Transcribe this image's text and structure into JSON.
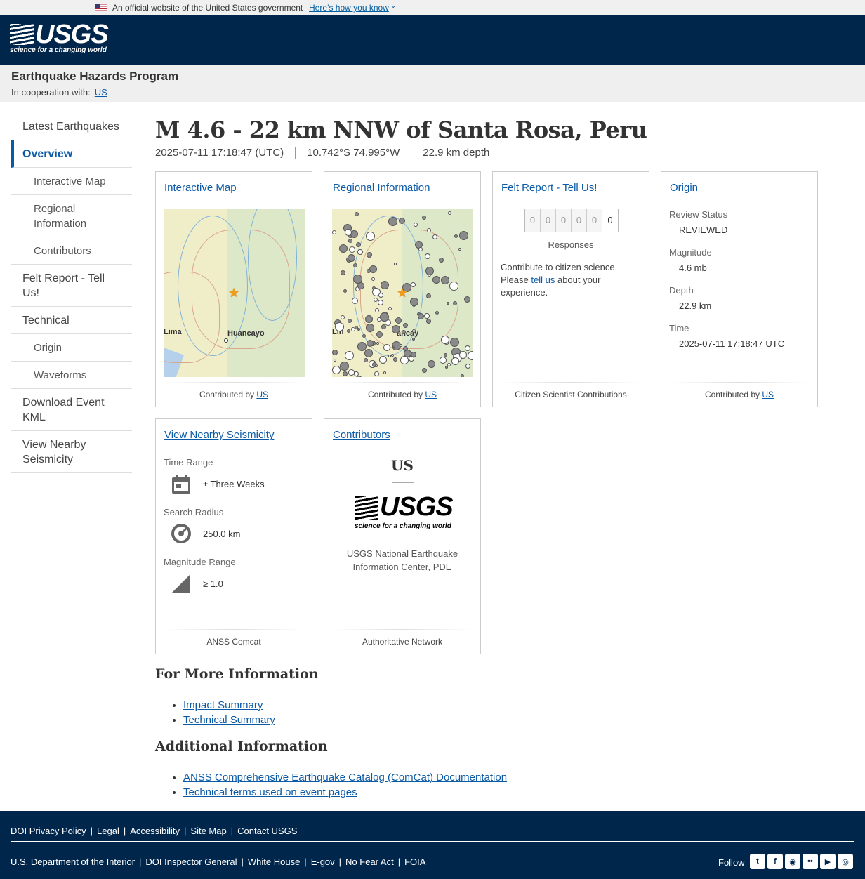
{
  "gov_banner": {
    "official_text": "An official website of the United States government",
    "how_link": "Here’s how you know"
  },
  "header": {
    "logo_word": "USGS",
    "logo_tagline": "science for a changing world"
  },
  "program": {
    "title": "Earthquake Hazards Program",
    "coop_label": "In cooperation with:",
    "coop_link": "US"
  },
  "sidebar": {
    "items": [
      {
        "label": "Latest Earthquakes"
      },
      {
        "label": "Overview"
      },
      {
        "label": "Interactive Map"
      },
      {
        "label": "Regional Information"
      },
      {
        "label": "Contributors"
      },
      {
        "label": "Felt Report - Tell Us!"
      },
      {
        "label": "Technical"
      },
      {
        "label": "Origin"
      },
      {
        "label": "Waveforms"
      },
      {
        "label": "Download Event KML"
      },
      {
        "label": "View Nearby Seismicity"
      }
    ]
  },
  "event": {
    "title": "M 4.6 - 22 km NNW of Santa Rosa, Peru",
    "time": "2025-07-11 17:18:47 (UTC)",
    "location": "10.742°S 74.995°W",
    "depth": "22.9 km depth"
  },
  "cards": {
    "interactive_map": {
      "title": "Interactive Map",
      "city_lima": "Lima",
      "city_huancayo": "Huancayo",
      "foot_prefix": "Contributed by",
      "foot_link": "US"
    },
    "regional": {
      "title": "Regional Information",
      "city_lima": "Lin",
      "city_huancayo": "ancay",
      "foot_prefix": "Contributed by",
      "foot_link": "US"
    },
    "felt": {
      "title": "Felt Report - Tell Us!",
      "digits": [
        "0",
        "0",
        "0",
        "0",
        "0",
        "0"
      ],
      "responses": "Responses",
      "text_before": "Contribute to citizen science. Please",
      "text_link": "tell us",
      "text_after": "about your experience.",
      "foot": "Citizen Scientist Contributions"
    },
    "origin": {
      "title": "Origin",
      "review_label": "Review Status",
      "review_value": "REVIEWED",
      "magnitude_label": "Magnitude",
      "magnitude_value": "4.6 mb",
      "depth_label": "Depth",
      "depth_value": "22.9 km",
      "time_label": "Time",
      "time_value": "2025-07-11 17:18:47 UTC",
      "foot_prefix": "Contributed by",
      "foot_link": "US"
    },
    "nearby": {
      "title": "View Nearby Seismicity",
      "time_label": "Time Range",
      "time_value": "± Three Weeks",
      "radius_label": "Search Radius",
      "radius_value": "250.0 km",
      "mag_label": "Magnitude Range",
      "mag_value": "≥ 1.0",
      "foot": "ANSS Comcat"
    },
    "contributors": {
      "title": "Contributors",
      "network": "US",
      "logo_word": "USGS",
      "logo_tagline": "science for a changing world",
      "name": "USGS National Earthquake Information Center, PDE",
      "foot": "Authoritative Network"
    }
  },
  "more_info": {
    "title": "For More Information",
    "links": [
      "Impact Summary",
      "Technical Summary"
    ]
  },
  "additional_info": {
    "title": "Additional Information",
    "links": [
      "ANSS Comprehensive Earthquake Catalog (ComCat) Documentation",
      "Technical terms used on event pages"
    ]
  },
  "footer": {
    "row1": [
      "DOI Privacy Policy",
      "Legal",
      "Accessibility",
      "Site Map",
      "Contact USGS"
    ],
    "row2": [
      "U.S. Department of the Interior",
      "DOI Inspector General",
      "White House",
      "E-gov",
      "No Fear Act",
      "FOIA"
    ],
    "follow": "Follow",
    "social_icons": [
      "twitter-icon",
      "facebook-icon",
      "github-icon",
      "flickr-icon",
      "youtube-icon",
      "instagram-icon"
    ]
  },
  "colors": {
    "header_bg": "#00264c",
    "link": "#0b5aa6",
    "event_star": "#f29b1a"
  }
}
